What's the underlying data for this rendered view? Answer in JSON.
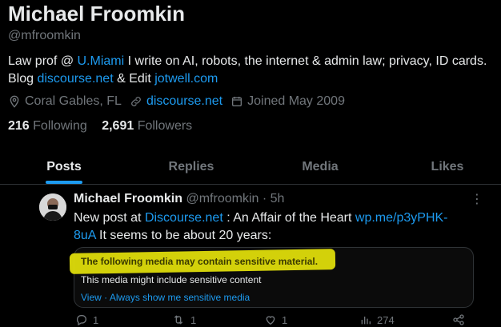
{
  "profile": {
    "name": "Michael Froomkin",
    "handle": "@mfroomkin",
    "bio": {
      "part1": "Law prof @ ",
      "link1": "U.Miami",
      "part2": " I write on AI, robots, the internet & admin law; privacy, ID cards. Blog ",
      "link2": "discourse.net",
      "part3": " & Edit ",
      "link3": "jotwell.com"
    },
    "location": "Coral Gables, FL",
    "website": "discourse.net",
    "joined": "Joined May 2009",
    "following_count": "216",
    "following_label": "Following",
    "followers_count": "2,691",
    "followers_label": "Followers"
  },
  "tabs": [
    "Posts",
    "Replies",
    "Media",
    "Likes"
  ],
  "post": {
    "author": "Michael Froomkin",
    "handle": "@mfroomkin",
    "sep": "·",
    "time": "5h",
    "text": {
      "part1": "New post at ",
      "link1": "Discourse.net",
      "part2": " : An Affair of the Heart ",
      "link2": "wp.me/p3yPHK-8uA",
      "part3": " It seems to be about 20 years:"
    },
    "media_warning": {
      "title": "The following media may contain sensitive material.",
      "subtitle": "This media might include sensitive content",
      "view": "View",
      "dot": "·",
      "always": "Always show me sensitive media"
    },
    "actions": {
      "replies": "1",
      "reposts": "1",
      "likes": "1",
      "views": "274"
    }
  },
  "colors": {
    "accent": "#1d9bf0",
    "highlight": "#dedc0b",
    "muted": "#71767b"
  }
}
